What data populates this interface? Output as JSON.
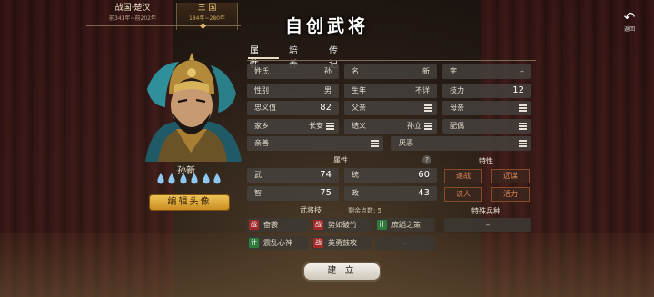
{
  "era": {
    "items": [
      {
        "name": "战国·楚汉",
        "range": "前341年~前202年"
      },
      {
        "name": "三 国",
        "range": "184年~280年"
      }
    ]
  },
  "title": "自创武将",
  "back": {
    "icon": "back-arrow-icon",
    "label": "返回"
  },
  "tabs": [
    {
      "label": "属性",
      "active": true
    },
    {
      "label": "培养",
      "active": false
    },
    {
      "label": "传记",
      "active": false
    }
  ],
  "hero": {
    "name": "孙新",
    "drops": 6,
    "edit_label": "编辑头像"
  },
  "fields": {
    "surname": {
      "label": "姓氏",
      "value": "孙"
    },
    "given_name": {
      "label": "名",
      "value": "新"
    },
    "courtesy": {
      "label": "字",
      "value": "–"
    },
    "gender": {
      "label": "性别",
      "value": "男"
    },
    "birth_year": {
      "label": "生年",
      "value": "不详"
    },
    "skill_power": {
      "label": "技力",
      "value": "12"
    },
    "loyalty": {
      "label": "忠义值",
      "value": "82"
    },
    "father": {
      "label": "父亲"
    },
    "mother": {
      "label": "母亲"
    },
    "hometown": {
      "label": "家乡",
      "value": "长安"
    },
    "sworn": {
      "label": "结义",
      "value": "孙立"
    },
    "spouse": {
      "label": "配偶"
    },
    "like": {
      "label": "亲善"
    },
    "dislike": {
      "label": "厌恶"
    }
  },
  "attributes": {
    "header": "属性",
    "items": [
      {
        "label": "武",
        "value": "74"
      },
      {
        "label": "统",
        "value": "60"
      },
      {
        "label": "智",
        "value": "75"
      },
      {
        "label": "政",
        "value": "43"
      }
    ]
  },
  "traits": {
    "header": "特性",
    "items": [
      "速战",
      "远谋",
      "识人",
      "活力"
    ]
  },
  "skills": {
    "header": "武将技",
    "points_label": "剩余点数:",
    "points_value": "5",
    "items": [
      {
        "tag": "战",
        "tag_color": "#a32828",
        "name": "奋袭"
      },
      {
        "tag": "战",
        "tag_color": "#a32828",
        "name": "势如破竹"
      },
      {
        "tag": "计",
        "tag_color": "#2f7a3a",
        "name": "庶蹈之策"
      },
      {
        "tag": "计",
        "tag_color": "#2f7a3a",
        "name": "震乱心神"
      },
      {
        "tag": "战",
        "tag_color": "#a32828",
        "name": "英勇鼓攻"
      },
      {
        "tag": "",
        "name": "–"
      }
    ]
  },
  "special_troop": {
    "header": "特殊兵种",
    "value": "–"
  },
  "create_label": "建 立"
}
